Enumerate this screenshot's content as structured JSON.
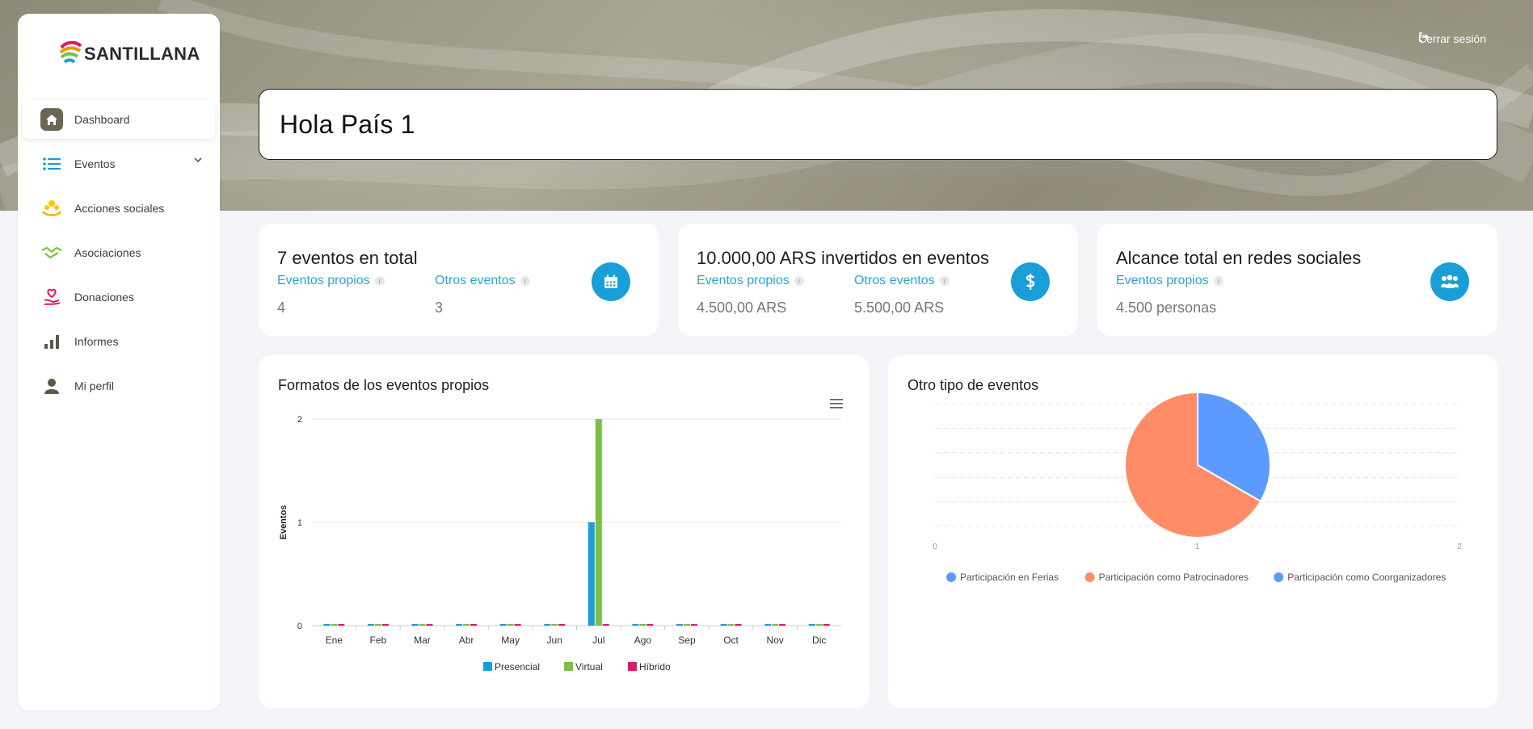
{
  "brand": {
    "name": "SANTILLANA"
  },
  "header": {
    "logout_label": "Cerrar sesión",
    "greeting": "Hola País 1"
  },
  "sidebar": {
    "items": [
      {
        "label": "Dashboard",
        "icon": "home-icon",
        "active": true
      },
      {
        "label": "Eventos",
        "icon": "list-icon",
        "expandable": true
      },
      {
        "label": "Acciones sociales",
        "icon": "hands-coins-icon"
      },
      {
        "label": "Asociaciones",
        "icon": "handshake-icon"
      },
      {
        "label": "Donaciones",
        "icon": "heart-hand-icon"
      },
      {
        "label": "Informes",
        "icon": "bar-chart-icon"
      },
      {
        "label": "Mi perfil",
        "icon": "user-icon"
      }
    ]
  },
  "stats": [
    {
      "title": "7 eventos en total",
      "icon": "calendar-icon",
      "subs": [
        {
          "label": "Eventos propios",
          "value": "4"
        },
        {
          "label": "Otros eventos",
          "value": "3"
        }
      ]
    },
    {
      "title": "10.000,00 ARS invertidos en eventos",
      "icon": "dollar-icon",
      "subs": [
        {
          "label": "Eventos propios",
          "value": "4.500,00 ARS"
        },
        {
          "label": "Otros eventos",
          "value": "5.500,00 ARS"
        }
      ]
    },
    {
      "title": "Alcance total en redes sociales",
      "icon": "people-icon",
      "subs": [
        {
          "label": "Eventos propios",
          "value": "4.500 personas"
        }
      ]
    }
  ],
  "colors": {
    "accent": "#1a9ed8",
    "presencial": "#1a9ed8",
    "virtual": "#7ac143",
    "hibrido": "#e0176f",
    "pie_blue": "#5b9bff",
    "pie_orange": "#ff8c66"
  },
  "chart_data": [
    {
      "type": "bar",
      "title": "Formatos de los eventos propios",
      "ylabel": "Eventos",
      "categories": [
        "Ene",
        "Feb",
        "Mar",
        "Abr",
        "May",
        "Jun",
        "Jul",
        "Ago",
        "Sep",
        "Oct",
        "Nov",
        "Dic"
      ],
      "ylim": [
        0,
        2
      ],
      "yticks": [
        "0",
        "1",
        "2"
      ],
      "grid": true,
      "legend": "bottom",
      "series": [
        {
          "name": "Presencial",
          "values": [
            0,
            0,
            0,
            0,
            0,
            0,
            1,
            0,
            0,
            0,
            0,
            0
          ]
        },
        {
          "name": "Virtual",
          "values": [
            0,
            0,
            0,
            0,
            0,
            0,
            2,
            0,
            0,
            0,
            0,
            0
          ]
        },
        {
          "name": "Híbrido",
          "values": [
            0,
            0,
            0,
            0,
            0,
            0,
            0,
            0,
            0,
            0,
            0,
            0
          ]
        }
      ]
    },
    {
      "type": "pie",
      "title": "Otro tipo de eventos",
      "xticks": [
        "0",
        "1",
        "2"
      ],
      "legend": "bottom",
      "slices": [
        {
          "label": "Participación en Ferias",
          "value": 1,
          "color": "#5b9bff"
        },
        {
          "label": "Participación como Patrocinadores",
          "value": 2,
          "color": "#ff8c66"
        },
        {
          "label": "Participación como Coorganizadores",
          "value": 0,
          "color": "#5b9bff"
        }
      ]
    }
  ]
}
